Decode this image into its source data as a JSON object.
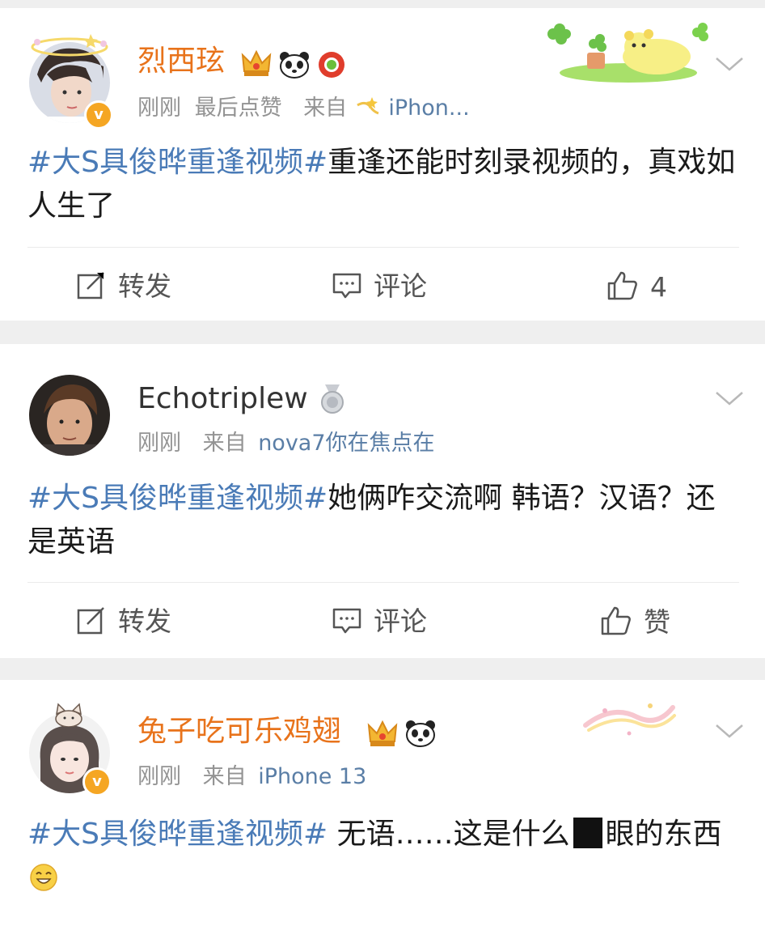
{
  "posts": [
    {
      "user": "烈西玹",
      "time": "刚刚",
      "extra": "最后点赞",
      "from_label": "来自",
      "source": "iPhon...",
      "hashtag": "#大S具俊晔重逢视频#",
      "text": "重逢还能时刻录视频的，真戏如人生了",
      "repost": "转发",
      "comment": "评论",
      "like": "4"
    },
    {
      "user": "Echotriplew",
      "time": "刚刚",
      "from_label": "来自",
      "source": "nova7你在焦点在",
      "hashtag": "#大S具俊晔重逢视频#",
      "text": "她俩咋交流啊 韩语？汉语？还是英语",
      "repost": "转发",
      "comment": "评论",
      "like": "赞"
    },
    {
      "user": "兔子吃可乐鸡翅",
      "time": "刚刚",
      "from_label": "来自",
      "source": "iPhone 13",
      "hashtag": "#大S具俊晔重逢视频#",
      "text_before": " 无语……这是什么",
      "text_after": "眼的东西"
    }
  ],
  "colors": {
    "vip_name": "#e8731b",
    "hashtag": "#4a7bb7",
    "verified": "#f5a623",
    "meta": "#939393"
  },
  "icons": [
    "crown-icon",
    "panda-icon",
    "red-flower-badge-icon",
    "medal-icon",
    "repost-icon",
    "comment-icon",
    "like-icon",
    "chevron-down-icon",
    "verified-icon",
    "clover-icon",
    "emoji-grin-icon"
  ]
}
